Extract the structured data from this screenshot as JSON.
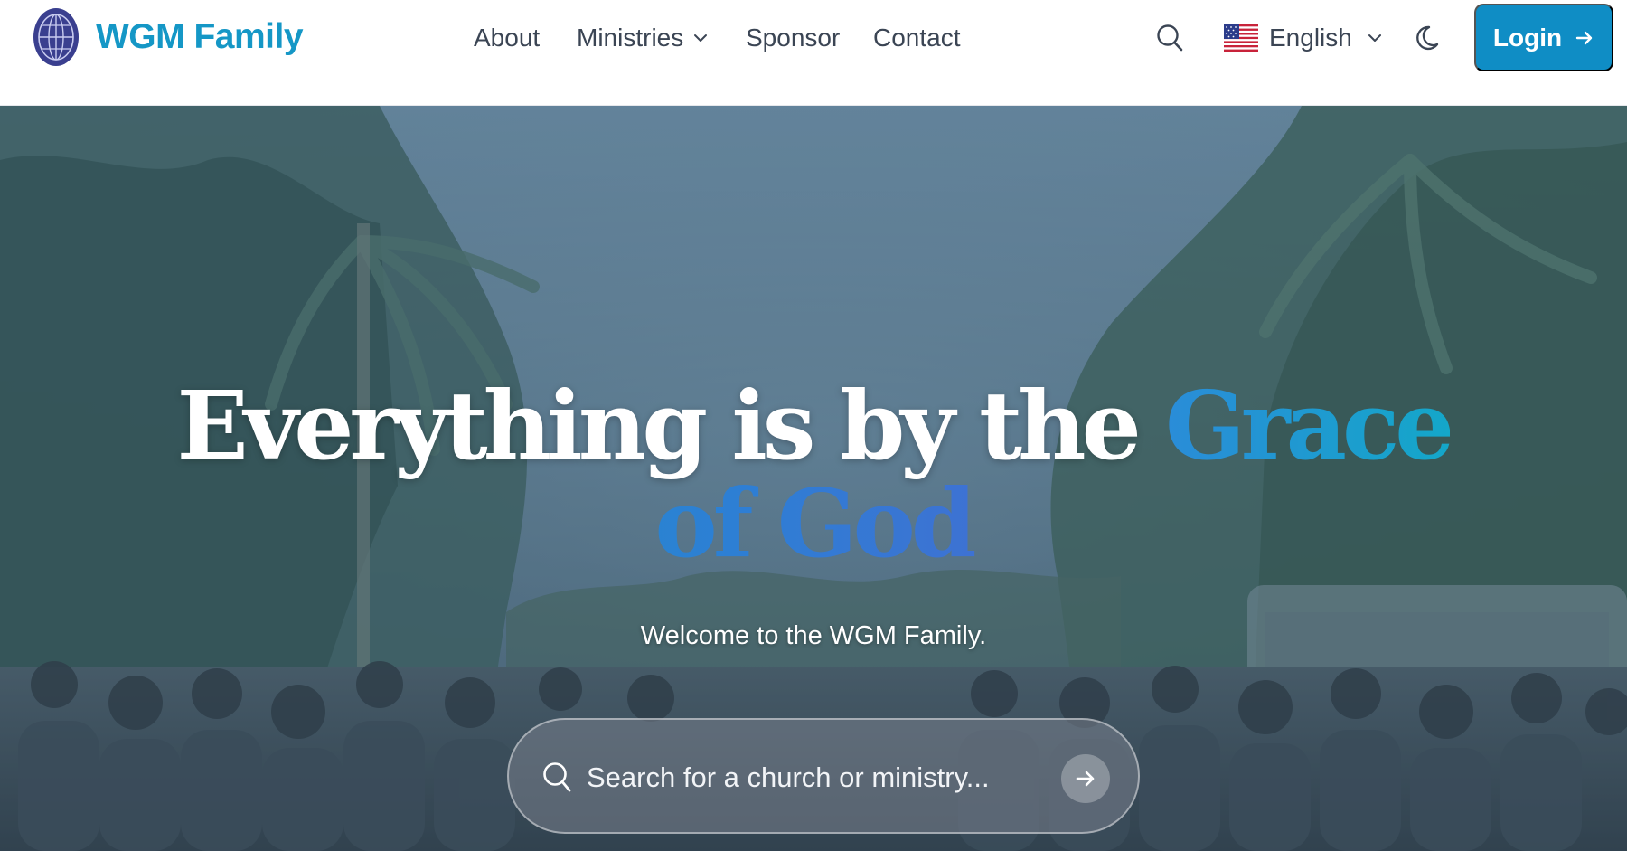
{
  "brand": {
    "name": "WGM Family",
    "logo_icon": "wgm-globe-logo",
    "color": "#1597c6"
  },
  "nav": {
    "items": [
      {
        "label": "About"
      },
      {
        "label": "Ministries",
        "has_dropdown": true
      },
      {
        "label": "Sponsor"
      },
      {
        "label": "Contact"
      }
    ]
  },
  "header": {
    "search_icon": "search-icon",
    "language": {
      "label": "English",
      "flag_icon": "us-flag-icon"
    },
    "theme_icon": "moon-icon",
    "login": {
      "label": "Login",
      "color": "#0f8dc5"
    }
  },
  "hero": {
    "headline_part1": "Everything is by the ",
    "headline_accent1": "Grace",
    "headline_accent2": "of God",
    "subtitle": "Welcome to the WGM Family.",
    "search": {
      "placeholder": "Search for a church or ministry...",
      "value": ""
    },
    "background": "outdoor crowd with palm trees under blue overlay"
  },
  "colors": {
    "accent_start": "#2a8cd8",
    "accent_mid": "#14a7c9",
    "accent_end": "#6a4fd0"
  }
}
